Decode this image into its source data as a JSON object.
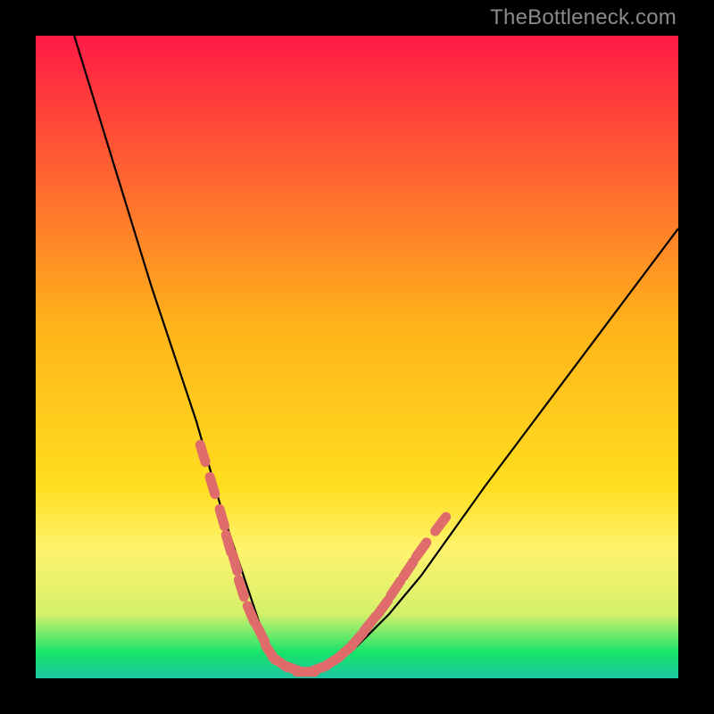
{
  "attribution": "TheBottleneck.com",
  "colors": {
    "frame": "#000000",
    "attribution_text": "#8a8a8a",
    "curve": "#000000",
    "marker_fill": "#e06b6b",
    "gradient_top": "#ff1a46",
    "gradient_mid": "#ffde1f",
    "gradient_yellow_band": "#fff36e",
    "gradient_green": "#17e46a",
    "gradient_teal": "#1dc6a3"
  },
  "chart_data": {
    "type": "line",
    "title": "",
    "xlabel": "",
    "ylabel": "",
    "xlim": [
      0,
      100
    ],
    "ylim": [
      0,
      100
    ],
    "comment": "V-shaped bottleneck curve. X is approximate horizontal position (0–100 across plot), Y is approximate height (0–100, 0=bottom). Values read from pixels; no axis labels shown in source.",
    "series": [
      {
        "name": "bottleneck-curve",
        "x": [
          6,
          10,
          14,
          18,
          22,
          25,
          27,
          29,
          31,
          33,
          35,
          37,
          40,
          43,
          46,
          50,
          55,
          60,
          65,
          70,
          76,
          82,
          88,
          94,
          100
        ],
        "y": [
          100,
          87,
          74,
          61,
          49,
          40,
          33,
          26,
          20,
          14,
          8,
          4,
          1,
          1,
          2,
          5,
          10,
          16,
          23,
          30,
          38,
          46,
          54,
          62,
          70
        ]
      }
    ],
    "markers": {
      "comment": "Pink segment markers clustered near the valley of the curve.",
      "points": [
        {
          "x": 26,
          "y": 35
        },
        {
          "x": 27.5,
          "y": 30
        },
        {
          "x": 29,
          "y": 25
        },
        {
          "x": 30,
          "y": 21
        },
        {
          "x": 31,
          "y": 18
        },
        {
          "x": 32,
          "y": 14
        },
        {
          "x": 33.5,
          "y": 10
        },
        {
          "x": 35,
          "y": 7
        },
        {
          "x": 36.5,
          "y": 4
        },
        {
          "x": 38,
          "y": 2.5
        },
        {
          "x": 40,
          "y": 1.5
        },
        {
          "x": 42,
          "y": 1
        },
        {
          "x": 44,
          "y": 1.5
        },
        {
          "x": 46,
          "y": 2.5
        },
        {
          "x": 48,
          "y": 4
        },
        {
          "x": 50,
          "y": 6
        },
        {
          "x": 52,
          "y": 8.5
        },
        {
          "x": 54,
          "y": 11
        },
        {
          "x": 56,
          "y": 14
        },
        {
          "x": 58,
          "y": 17
        },
        {
          "x": 60,
          "y": 20
        },
        {
          "x": 63,
          "y": 24
        }
      ]
    },
    "gradient_stops": [
      {
        "pos": 0.0,
        "color": "#ff1a46"
      },
      {
        "pos": 0.45,
        "color": "#ffb31a"
      },
      {
        "pos": 0.7,
        "color": "#ffde1f"
      },
      {
        "pos": 0.8,
        "color": "#fff36e"
      },
      {
        "pos": 0.9,
        "color": "#d4f06a"
      },
      {
        "pos": 0.96,
        "color": "#17e46a"
      },
      {
        "pos": 1.0,
        "color": "#1dc6a3"
      }
    ]
  }
}
